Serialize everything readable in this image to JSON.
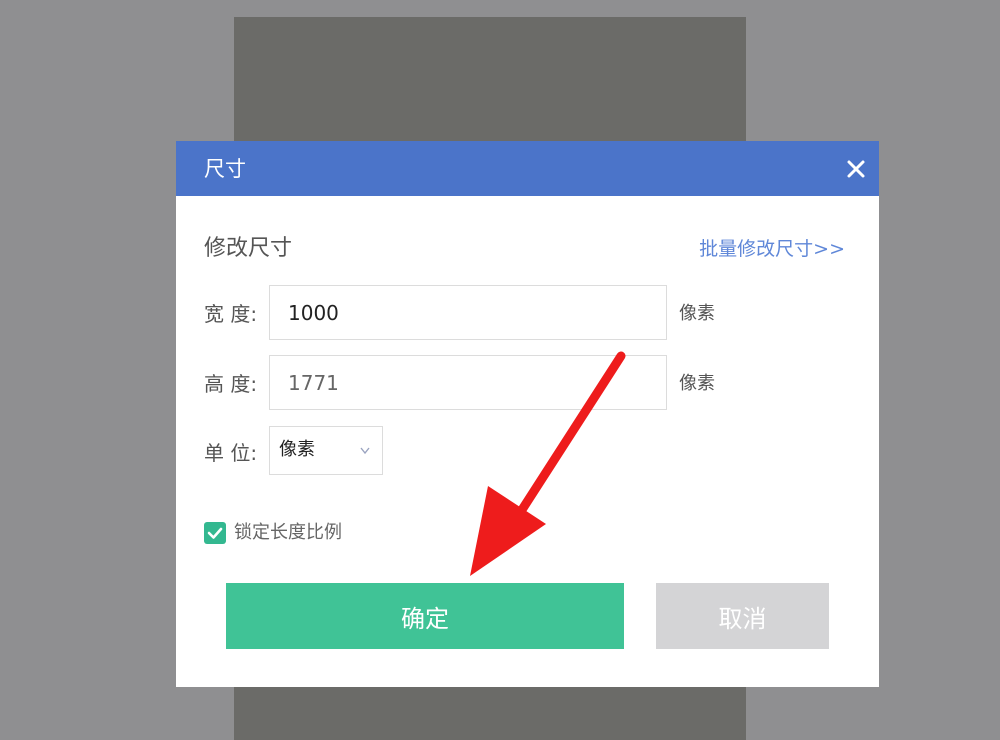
{
  "dialog": {
    "title": "尺寸",
    "section_title": "修改尺寸",
    "batch_link": "批量修改尺寸>>",
    "width": {
      "label": "宽 度:",
      "value": "1000",
      "unit": "像素"
    },
    "height": {
      "label": "高 度:",
      "value": "1771",
      "unit": "像素"
    },
    "unit": {
      "label": "单 位:",
      "selected": "像素"
    },
    "lock_ratio": {
      "label": "锁定长度比例",
      "checked": true
    },
    "ok_label": "确定",
    "cancel_label": "取消"
  },
  "colors": {
    "header": "#4b74c9",
    "ok_button": "#40c396",
    "cancel_button": "#d4d4d6",
    "checkbox": "#33b890",
    "link": "#5f87d8",
    "arrow": "#ee1c1c"
  },
  "icons": {
    "close": "close-icon",
    "select_caret": "chevron-down-icon",
    "checkbox": "checkmark-icon",
    "annotation": "red-arrow-icon"
  }
}
